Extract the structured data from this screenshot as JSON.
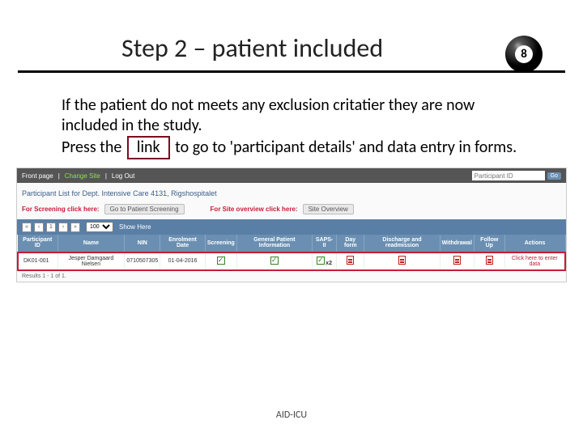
{
  "title": "Step 2 – patient included",
  "eightball": "8",
  "body": {
    "line1": "If the patient do not meets any exclusion critatier they are now included in the study.",
    "line2a": "Press the",
    "link_word": "link",
    "line2b": "to go to 'participant details' and data entry in forms."
  },
  "topbar": {
    "front": "Front page",
    "sep": " | ",
    "change_site": "Change Site",
    "logout": "Log Out",
    "search_placeholder": "Participant ID",
    "go": "Go"
  },
  "section_title": "Participant List for Dept. Intensive Care 4131, Rigshospitalet",
  "actions": {
    "screening_label": "For Screening click here:",
    "screening_btn": "Go to Patient Screening",
    "overview_label": "For Site overview click here:",
    "overview_btn": "Site Overview"
  },
  "pager": {
    "first": "«",
    "prev": "‹",
    "page": "1",
    "next": "›",
    "last": "»",
    "per": "100",
    "show_here": "Show Here"
  },
  "columns": [
    "Participant ID",
    "Name",
    "NIN",
    "Enrolment Date",
    "Screening",
    "General Patient Information",
    "SAPS-II",
    "Day form",
    "Discharge and readmission",
    "Withdrawal",
    "Follow Up",
    "Actions"
  ],
  "row": {
    "pid": "DK01-001",
    "name": "Jesper Damgaard Nielsen",
    "nin": "0710507305",
    "date": "01-04-2016",
    "x2": "x2",
    "actions": "Click here to enter data"
  },
  "results": "Results 1 - 1 of 1.",
  "footer": "AID-ICU"
}
